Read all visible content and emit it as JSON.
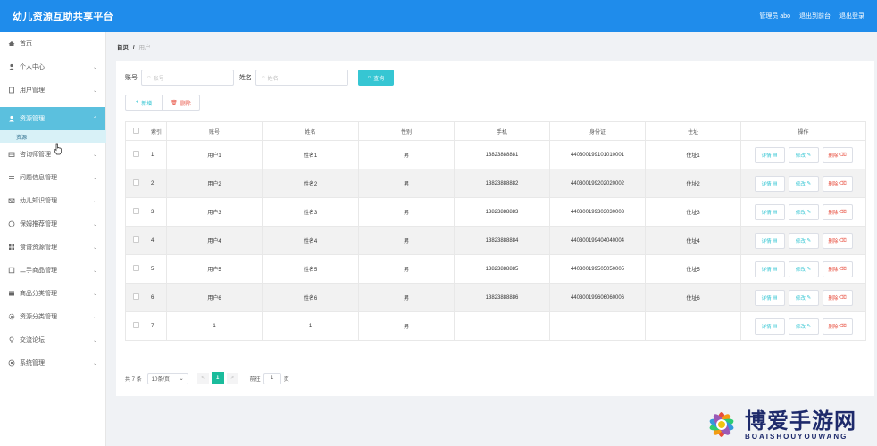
{
  "header": {
    "title": "幼儿资源互助共享平台",
    "admin": "管理员 abo",
    "back_to_frontend": "退出到前台",
    "logout": "退出登录"
  },
  "sidebar": {
    "items": [
      {
        "label": "首页",
        "icon": "home-icon",
        "has_children": false
      },
      {
        "label": "个人中心",
        "icon": "user-icon",
        "has_children": true
      },
      {
        "label": "用户管理",
        "icon": "doc-icon",
        "has_children": true
      },
      {
        "label": "资源管理",
        "icon": "user-icon",
        "has_children": true,
        "active": true
      },
      {
        "label": "咨询师管理",
        "icon": "box-icon",
        "has_children": true
      },
      {
        "label": "问题信息管理",
        "icon": "list-icon",
        "has_children": true
      },
      {
        "label": "幼儿知识管理",
        "icon": "mail-icon",
        "has_children": true
      },
      {
        "label": "保姆推荐管理",
        "icon": "circle-icon",
        "has_children": true
      },
      {
        "label": "食谱资源管理",
        "icon": "grid-icon",
        "has_children": true
      },
      {
        "label": "二手商品管理",
        "icon": "square-icon",
        "has_children": true
      },
      {
        "label": "商品分类管理",
        "icon": "card-icon",
        "has_children": true
      },
      {
        "label": "资源分类管理",
        "icon": "gear-icon",
        "has_children": true
      },
      {
        "label": "交流论坛",
        "icon": "pin-icon",
        "has_children": true
      },
      {
        "label": "系统管理",
        "icon": "settings-icon",
        "has_children": true
      }
    ],
    "active_sub": "资源"
  },
  "breadcrumb": {
    "home": "首页",
    "separator": "/",
    "current": "用户"
  },
  "search": {
    "account_label": "账号",
    "account_placeholder": "账号",
    "name_label": "姓名",
    "name_placeholder": "姓名",
    "query_button": "查询"
  },
  "actions": {
    "add": "新增",
    "delete": "删除"
  },
  "table": {
    "headers": [
      "索引",
      "账号",
      "姓名",
      "性别",
      "手机",
      "身份证",
      "住址",
      "操作"
    ],
    "rows": [
      {
        "index": "1",
        "account": "用户1",
        "name": "姓名1",
        "gender": "男",
        "phone": "13823888881",
        "id_card": "440300199101010001",
        "address": "住址1"
      },
      {
        "index": "2",
        "account": "用户2",
        "name": "姓名2",
        "gender": "男",
        "phone": "13823888882",
        "id_card": "440300199202020002",
        "address": "住址2"
      },
      {
        "index": "3",
        "account": "用户3",
        "name": "姓名3",
        "gender": "男",
        "phone": "13823888883",
        "id_card": "440300199303030003",
        "address": "住址3"
      },
      {
        "index": "4",
        "account": "用户4",
        "name": "姓名4",
        "gender": "男",
        "phone": "13823888884",
        "id_card": "440300199404040004",
        "address": "住址4"
      },
      {
        "index": "5",
        "account": "用户5",
        "name": "姓名5",
        "gender": "男",
        "phone": "13823888885",
        "id_card": "440300199505050005",
        "address": "住址5"
      },
      {
        "index": "6",
        "account": "用户6",
        "name": "姓名6",
        "gender": "男",
        "phone": "13823888886",
        "id_card": "440300199606060006",
        "address": "住址6"
      },
      {
        "index": "7",
        "account": "1",
        "name": "1",
        "gender": "男",
        "phone": "",
        "id_card": "",
        "address": ""
      }
    ],
    "op_detail": "详情",
    "op_edit": "修改",
    "op_delete": "删除"
  },
  "pager": {
    "total": "共 7 条",
    "page_size": "10条/页",
    "current_page": "1",
    "goto_label": "前往",
    "goto_value": "1",
    "page_suffix": "页"
  },
  "watermark": {
    "big": "博爱手游网",
    "small": "BOAISHOUYOUWANG"
  },
  "colors": {
    "header_bg": "#1f8ceb",
    "active_menu": "#5bc0de",
    "query_button": "#36c6d3",
    "delete": "#e74c3c",
    "page_active": "#1abc9c"
  }
}
